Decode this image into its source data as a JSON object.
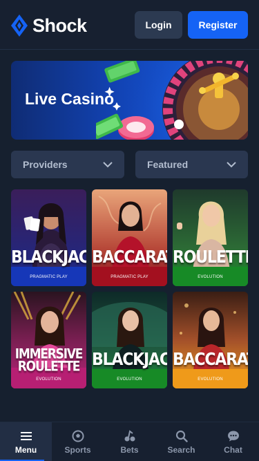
{
  "header": {
    "logo_text": "Shock",
    "login_label": "Login",
    "register_label": "Register"
  },
  "banner": {
    "title": "Live Casino"
  },
  "filters": {
    "providers_label": "Providers",
    "featured_label": "Featured"
  },
  "games": [
    {
      "name": "BLACKJACK",
      "provider": "PRAGMATIC PLAY"
    },
    {
      "name": "BACCARAT",
      "provider": "PRAGMATIC PLAY"
    },
    {
      "name": "ROULETTE",
      "provider": "EVOLUTION"
    },
    {
      "name_line1": "IMMERSIVE",
      "name_line2": "ROULETTE",
      "provider": "EVOLUTION"
    },
    {
      "name": "BLACKJACK",
      "provider": "EVOLUTION"
    },
    {
      "name": "BACCARAT",
      "provider": "EVOLUTION"
    }
  ],
  "bottom_nav": [
    {
      "label": "Menu",
      "icon": "menu-icon",
      "active": true
    },
    {
      "label": "Sports",
      "icon": "soccer-ball-icon"
    },
    {
      "label": "Bets",
      "icon": "bets-icon"
    },
    {
      "label": "Search",
      "icon": "search-icon"
    },
    {
      "label": "Chat",
      "icon": "chat-icon"
    }
  ],
  "colors": {
    "background": "#16202f",
    "accent": "#1563f5",
    "surface": "#2a3750"
  }
}
